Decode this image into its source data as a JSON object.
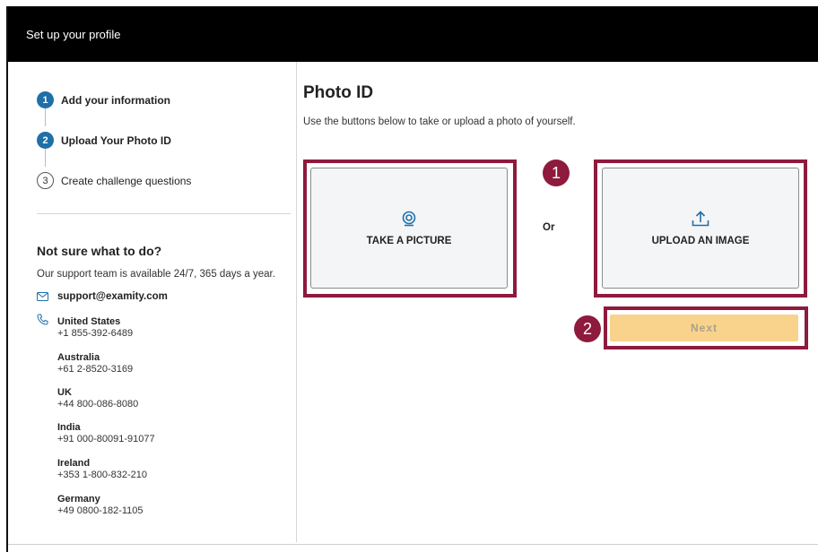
{
  "header": {
    "title": "Set up your profile"
  },
  "steps": [
    {
      "number": "1",
      "label": "Add your information"
    },
    {
      "number": "2",
      "label": "Upload Your Photo ID"
    },
    {
      "number": "3",
      "label": "Create challenge questions"
    }
  ],
  "help": {
    "title": "Not sure what to do?",
    "text": "Our support team is available 24/7, 365 days a year.",
    "email": "support@examity.com",
    "contacts": [
      {
        "country": "United States",
        "phone": "+1 855-392-6489"
      },
      {
        "country": "Australia",
        "phone": "+61 2-8520-3169"
      },
      {
        "country": "UK",
        "phone": "+44 800-086-8080"
      },
      {
        "country": "India",
        "phone": "+91 000-80091-91077"
      },
      {
        "country": "Ireland",
        "phone": "+353 1-800-832-210"
      },
      {
        "country": "Germany",
        "phone": "+49 0800-182-1105"
      }
    ]
  },
  "main": {
    "title": "Photo ID",
    "subtitle": "Use the buttons below to take or upload a photo of yourself.",
    "take_picture_label": "TAKE A PICTURE",
    "or_label": "Or",
    "upload_label": "UPLOAD AN IMAGE",
    "next_label": "Next"
  },
  "annotations": {
    "badge1": "1",
    "badge2": "2"
  },
  "icons": {
    "take_picture": "webcam-icon",
    "upload": "upload-icon",
    "email": "mail-icon",
    "phone": "phone-icon"
  },
  "colors": {
    "header_bg": "#000000",
    "step_active": "#1f6fa8",
    "icon_blue": "#1f6fa8",
    "highlight": "#8e1a3d",
    "next_bg": "#f9d38c"
  }
}
